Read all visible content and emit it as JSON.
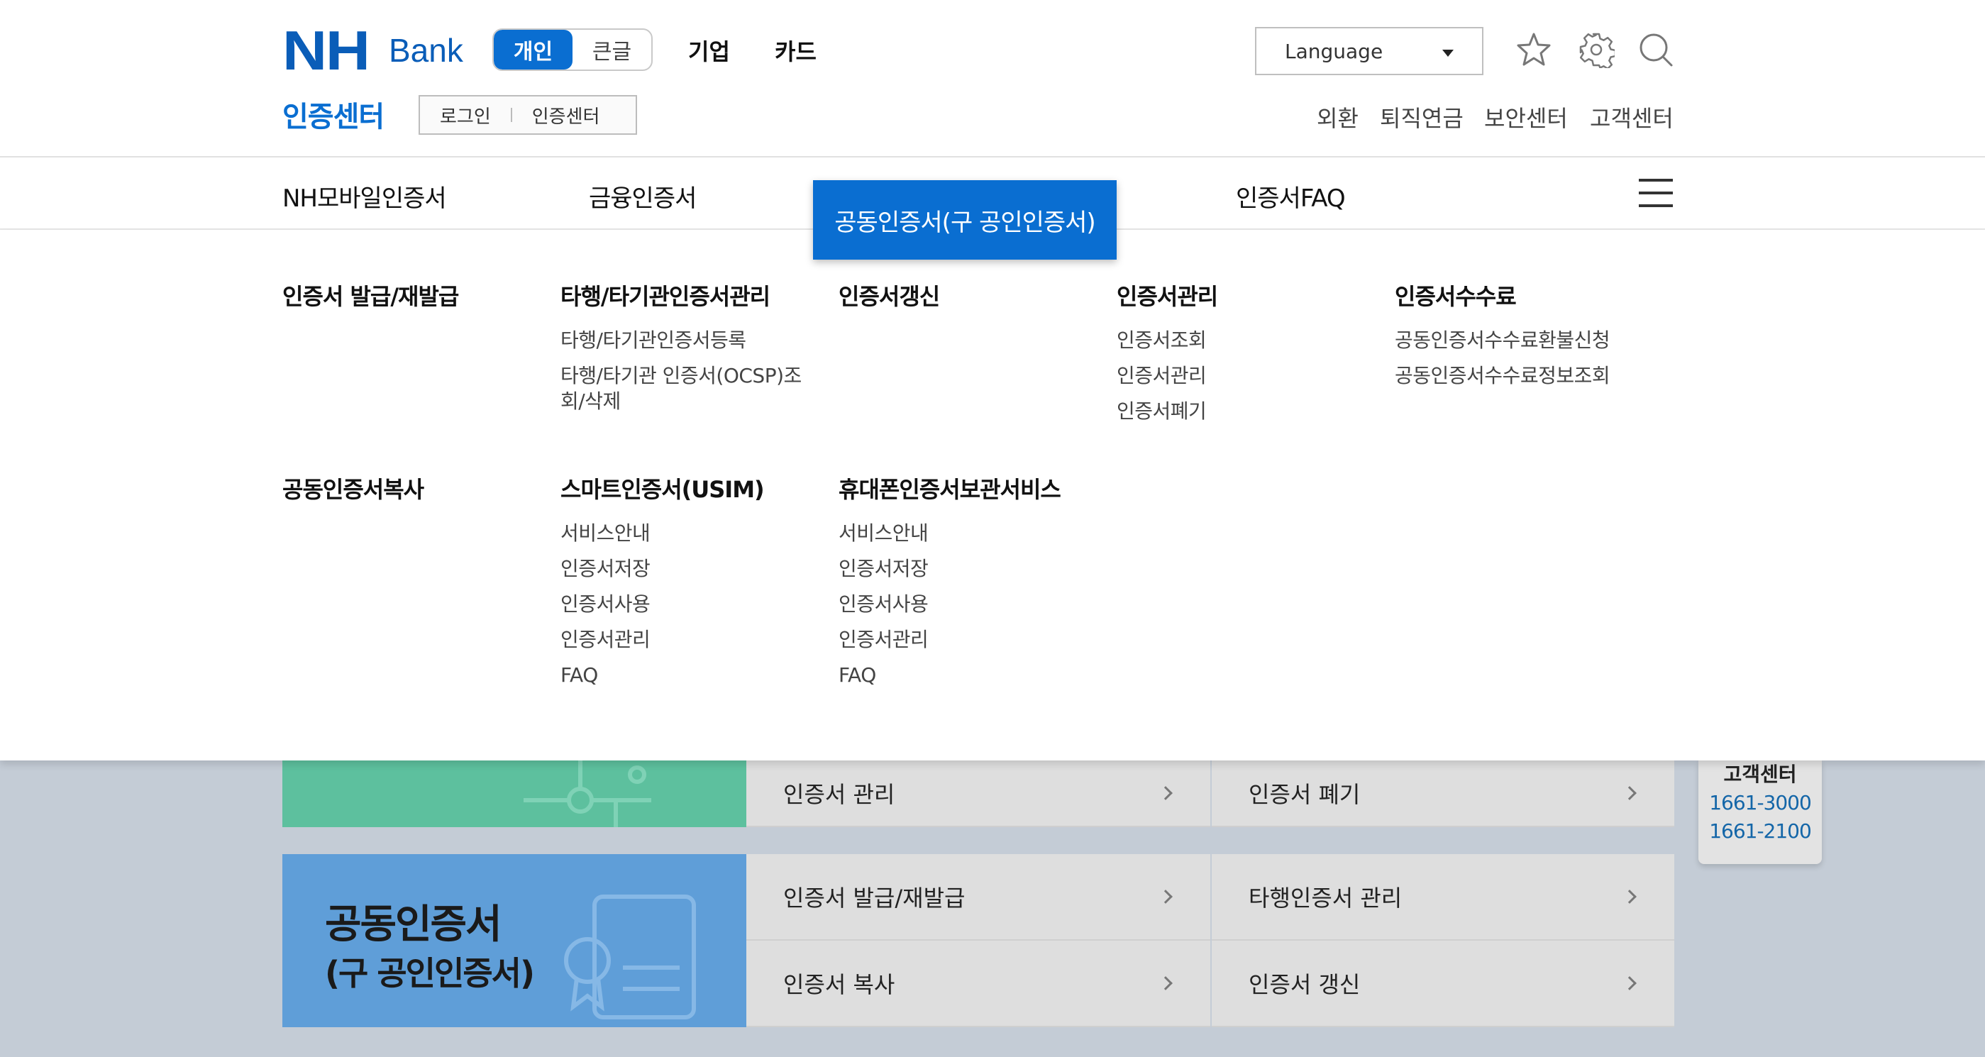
{
  "header": {
    "logo_nh": "NH",
    "logo_bank": "Bank",
    "segment": [
      "개인",
      "큰글"
    ],
    "top_links": [
      "기업",
      "카드"
    ],
    "language": "Language",
    "sub_title": "인증센터",
    "sub_links": [
      "로그인",
      "인증센터"
    ],
    "util_links": [
      "외환",
      "퇴직연금",
      "보안센터",
      "고객센터"
    ]
  },
  "gnb": {
    "items": [
      "NH모바일인증서",
      "금융인증서",
      "공동인증서(구 공인인증서)",
      "인증서FAQ"
    ],
    "active_index": 2
  },
  "mega": {
    "columns": [
      {
        "title": "인증서 발급/재발급",
        "links": []
      },
      {
        "title": "타행/타기관인증서관리",
        "links": [
          "타행/타기관인증서등록",
          "타행/타기관 인증서(OCSP)조",
          "회/삭제"
        ]
      },
      {
        "title": "인증서갱신",
        "links": []
      },
      {
        "title": "인증서관리",
        "links": [
          "인증서조회",
          "인증서관리",
          "인증서폐기"
        ]
      },
      {
        "title": "인증서수수료",
        "links": [
          "공동인증서수수료환불신청",
          "공동인증서수수료정보조회"
        ]
      },
      {
        "title": "공동인증서복사",
        "links": []
      },
      {
        "title": "스마트인증서(USIM)",
        "links": [
          "서비스안내",
          "인증서저장",
          "인증서사용",
          "인증서관리",
          "FAQ"
        ]
      },
      {
        "title": "휴대폰인증서보관서비스",
        "links": [
          "서비스안내",
          "인증서저장",
          "인증서사용",
          "인증서관리",
          "FAQ"
        ]
      }
    ]
  },
  "content": {
    "card_title": "공동인증서",
    "card_sub": "(구 공인인증서)",
    "row1": [
      "인증서 관리",
      "인증서 폐기"
    ],
    "row2": [
      "인증서 발급/재발급",
      "타행인증서 관리"
    ],
    "row3": [
      "인증서 복사",
      "인증서 갱신"
    ]
  },
  "customer_center": {
    "title": "고객센터",
    "numbers": [
      "1661-3000",
      "1661-2100"
    ]
  },
  "colors": {
    "brand": "#0a5db8",
    "accent": "#0a6ed1",
    "green_card": "#5dc09e",
    "blue_card": "#5f9ed8"
  }
}
